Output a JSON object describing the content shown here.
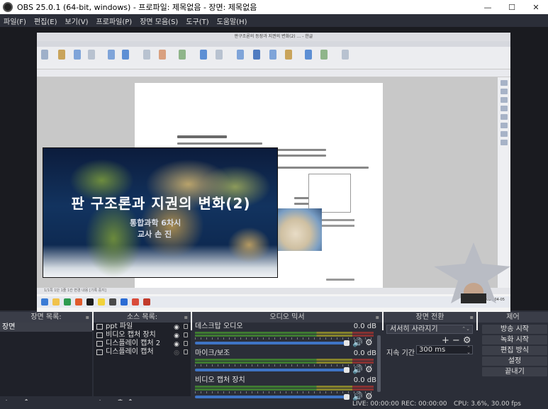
{
  "window": {
    "title": "OBS 25.0.1 (64-bit, windows) - 프로파일: 제목없음 - 장면: 제목없음",
    "controls": {
      "minimize": "—",
      "maximize": "☐",
      "close": "✕"
    }
  },
  "menu": [
    "파일(F)",
    "편집(E)",
    "보기(V)",
    "프로파일(P)",
    "장면 모음(S)",
    "도구(T)",
    "도움말(H)"
  ],
  "preview": {
    "doc_window_title": "판구조론의 등장과 지권의 변화(2) ... - 한글",
    "ppt_status": "1/1쪽  1단  1줄  1칸  변경 내용 [기록 중지]",
    "taskbar_clock": "오후 12:50\n2020-04-05",
    "slide": {
      "title": "판  구조론과  지권의  변화(2)",
      "subtitle": "통합과학   6차시",
      "teacher": "교사  손  진"
    }
  },
  "docks": {
    "scenes": {
      "header": "장면 목록:",
      "items": [
        "장면"
      ],
      "footer": [
        "+",
        "−",
        "⌃",
        "⌄"
      ]
    },
    "sources": {
      "header": "소스 목록:",
      "items": [
        {
          "name": "ppt 파일",
          "icon": "folder-icon"
        },
        {
          "name": "비디오 캡처 장치",
          "icon": "camera-icon"
        },
        {
          "name": "디스플레이 캡처 2",
          "icon": "monitor-icon"
        },
        {
          "name": "디스플레이 캡처",
          "icon": "monitor-icon"
        }
      ],
      "footer": [
        "+",
        "−",
        "⚙",
        "⌃",
        "⌄"
      ]
    },
    "mixer": {
      "header": "오디오 믹서",
      "tracks": [
        {
          "name": "데스크탑 오디오",
          "db": "0.0 dB"
        },
        {
          "name": "마이크/보조",
          "db": "0.0 dB"
        },
        {
          "name": "비디오 캡처 장치",
          "db": "0.0 dB"
        }
      ]
    },
    "transitions": {
      "header": "장면 전환",
      "selected": "서서히 사라지기",
      "duration_label": "지속 기간",
      "duration_value": "300 ms"
    },
    "controls": {
      "header": "제어",
      "buttons": [
        "방송 시작",
        "녹화 시작",
        "편집 방식",
        "설정",
        "끝내기"
      ]
    }
  },
  "status": {
    "live": "LIVE: 00:00:00",
    "rec": "REC: 00:00:00",
    "cpu": "CPU: 3.6%, 30.00 fps"
  },
  "colors": {
    "bg": "#2b2e38",
    "slider": "#3f74c5",
    "meter_green": "#3f7a32",
    "meter_yellow": "#85822c",
    "meter_red": "#873232"
  }
}
